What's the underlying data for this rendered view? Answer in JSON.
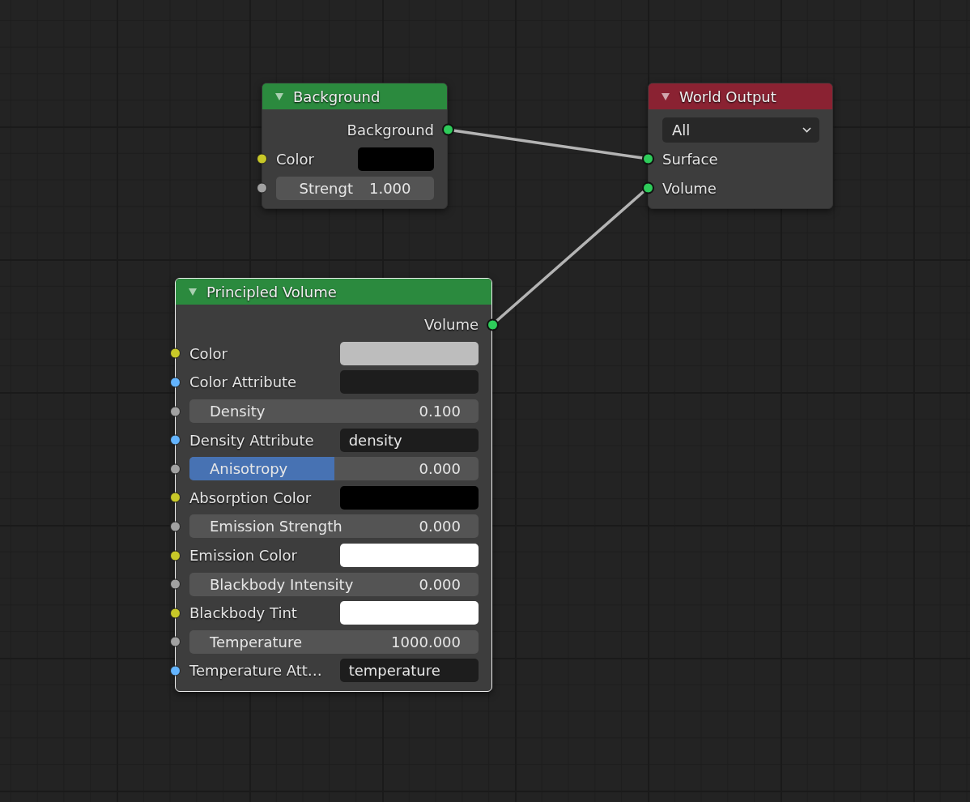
{
  "nodes": [
    {
      "title": "Background",
      "color": "#2b8a3e",
      "selected": false,
      "rows": [
        {
          "kind": "output",
          "label": "Background",
          "color": "#2ecc5a",
          "connected": true
        },
        {
          "kind": "color",
          "label": "Color",
          "color": "#c8c828",
          "connected": false,
          "swatch": {
            "color": "#000000"
          }
        },
        {
          "kind": "value",
          "label": "Strengt",
          "value": "1.000",
          "color": "#a1a1a1",
          "connected": false,
          "centered": true
        }
      ]
    },
    {
      "title": "World Output",
      "color": "#8a2232",
      "selected": false,
      "rows": [
        {
          "kind": "dropdown",
          "value": "All"
        },
        {
          "kind": "socket",
          "label": "Surface",
          "color": "#2ecc5a",
          "connected": true
        },
        {
          "kind": "socket",
          "label": "Volume",
          "color": "#2ecc5a",
          "connected": true
        }
      ]
    },
    {
      "title": "Principled Volume",
      "color": "#2b8a3e",
      "selected": true,
      "rows": [
        {
          "kind": "output",
          "label": "Volume",
          "color": "#2ecc5a",
          "connected": true
        },
        {
          "kind": "color",
          "label": "Color",
          "color": "#c8c828",
          "connected": false,
          "swatch": {
            "color": "#bdbdbd"
          }
        },
        {
          "kind": "color",
          "label": "Color Attribute",
          "color": "#63b4ff",
          "connected": false,
          "swatch": {
            "color": "#1d1d1d"
          }
        },
        {
          "kind": "value",
          "label": "Density",
          "value": "0.100",
          "color": "#a1a1a1",
          "connected": false
        },
        {
          "kind": "attribute",
          "label": "Density Attribute",
          "value": "density",
          "color": "#63b4ff",
          "connected": false
        },
        {
          "kind": "slider",
          "label": "Anisotropy",
          "value": "0.000",
          "level": 0.5,
          "color": "#a1a1a1",
          "connected": false
        },
        {
          "kind": "color",
          "label": "Absorption Color",
          "color": "#c8c828",
          "connected": false,
          "swatch": {
            "color": "#000000"
          }
        },
        {
          "kind": "value",
          "label": "Emission Strength",
          "value": "0.000",
          "color": "#a1a1a1",
          "connected": false
        },
        {
          "kind": "color",
          "label": "Emission Color",
          "color": "#c8c828",
          "connected": false,
          "swatch": {
            "color": "#ffffff"
          }
        },
        {
          "kind": "value",
          "label": "Blackbody Intensity",
          "value": "0.000",
          "color": "#a1a1a1",
          "connected": false
        },
        {
          "kind": "color",
          "label": "Blackbody Tint",
          "color": "#c8c828",
          "connected": false,
          "swatch": {
            "color": "#ffffff"
          }
        },
        {
          "kind": "value",
          "label": "Temperature",
          "value": "1000.000",
          "color": "#a1a1a1",
          "connected": false
        },
        {
          "kind": "attribute",
          "label": "Temperature Att…",
          "value": "temperature",
          "color": "#63b4ff",
          "connected": false
        }
      ]
    }
  ]
}
